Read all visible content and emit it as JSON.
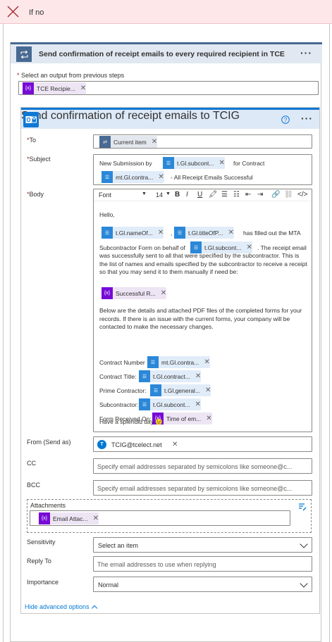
{
  "header": {
    "title": "If no"
  },
  "foreach": {
    "title": "Send confirmation of receipt emails to every required recipient in TCE",
    "select_label": "Select an output from previous steps",
    "select_token": "TCE Recipie..."
  },
  "action": {
    "title": "Send confirmation of receipt emails to TCIG",
    "to": {
      "label": "To",
      "token": "Current item"
    },
    "subject": {
      "label": "Subject",
      "text1": "New Submission by",
      "token1": "t.Gl.subcont...",
      "text2": "for Contract",
      "token2": "mt.Gl.contra...",
      "text3": "- All Receipt Emails Successful"
    },
    "body": {
      "label": "Body",
      "font": "Font",
      "size": "14",
      "hello": "Hello,",
      "token_name": "t.Gl.nameOf...",
      "comma": ",",
      "token_title": "t.Gl.titleOfP...",
      "filled": "has filled out the MTA",
      "behalf": "Subcontractor Form on behalf of",
      "token_sub": "t.Gl.subcont...",
      "receipt1": ". The receipt email",
      "para1": "was successfully sent to all that were specified by the subcontractor. This is the list of names and emails specified by the subcontractor to receive a receipt so that you may send it to them manually if need be:",
      "token_success": "Successful R...",
      "para2": "Below are the details and attached PDF files of the completed forms for your records. If there is an issue with the current forms, your company will be contacted to make the necessary changes.",
      "rows": [
        {
          "label": "Contract Number",
          "token": "mt.Gl.contra..."
        },
        {
          "label": "Contract Title:",
          "token": "t.Gl.contract..."
        },
        {
          "label": "Prime Contractor:",
          "token": "t.Gl.general..."
        },
        {
          "label": "Subcontractor:",
          "token": "t.Gl.subcont..."
        },
        {
          "label": "Form Received On:",
          "token": "Time of em..."
        }
      ],
      "closing": "Have a splendid day",
      "emoji": "😉"
    },
    "from": {
      "label": "From (Send as)",
      "avatar": "T",
      "value": "TCIG@tcelect.net"
    },
    "cc": {
      "label": "CC",
      "placeholder": "Specify email addresses separated by semicolons like someone@c..."
    },
    "bcc": {
      "label": "BCC",
      "placeholder": "Specify email addresses separated by semicolons like someone@c..."
    },
    "attachments": {
      "label": "Attachments",
      "token": "Email Attac..."
    },
    "sensitivity": {
      "label": "Sensitivity",
      "placeholder": "Select an item"
    },
    "replyto": {
      "label": "Reply To",
      "placeholder": "The email addresses to use when replying"
    },
    "importance": {
      "label": "Importance",
      "value": "Normal"
    },
    "advanced": "Hide advanced options"
  },
  "colors": {
    "accent": "#0078d4",
    "purple": "#770bd6",
    "slate": "#486991",
    "error_bar": "#fde7e9"
  },
  "icons": [
    "close-icon",
    "loop-icon",
    "outlook-icon",
    "help-icon",
    "more-icon",
    "variable-icon",
    "dynamic-content-icon",
    "avatar-icon",
    "chevron-down-icon",
    "chevron-up-icon"
  ]
}
